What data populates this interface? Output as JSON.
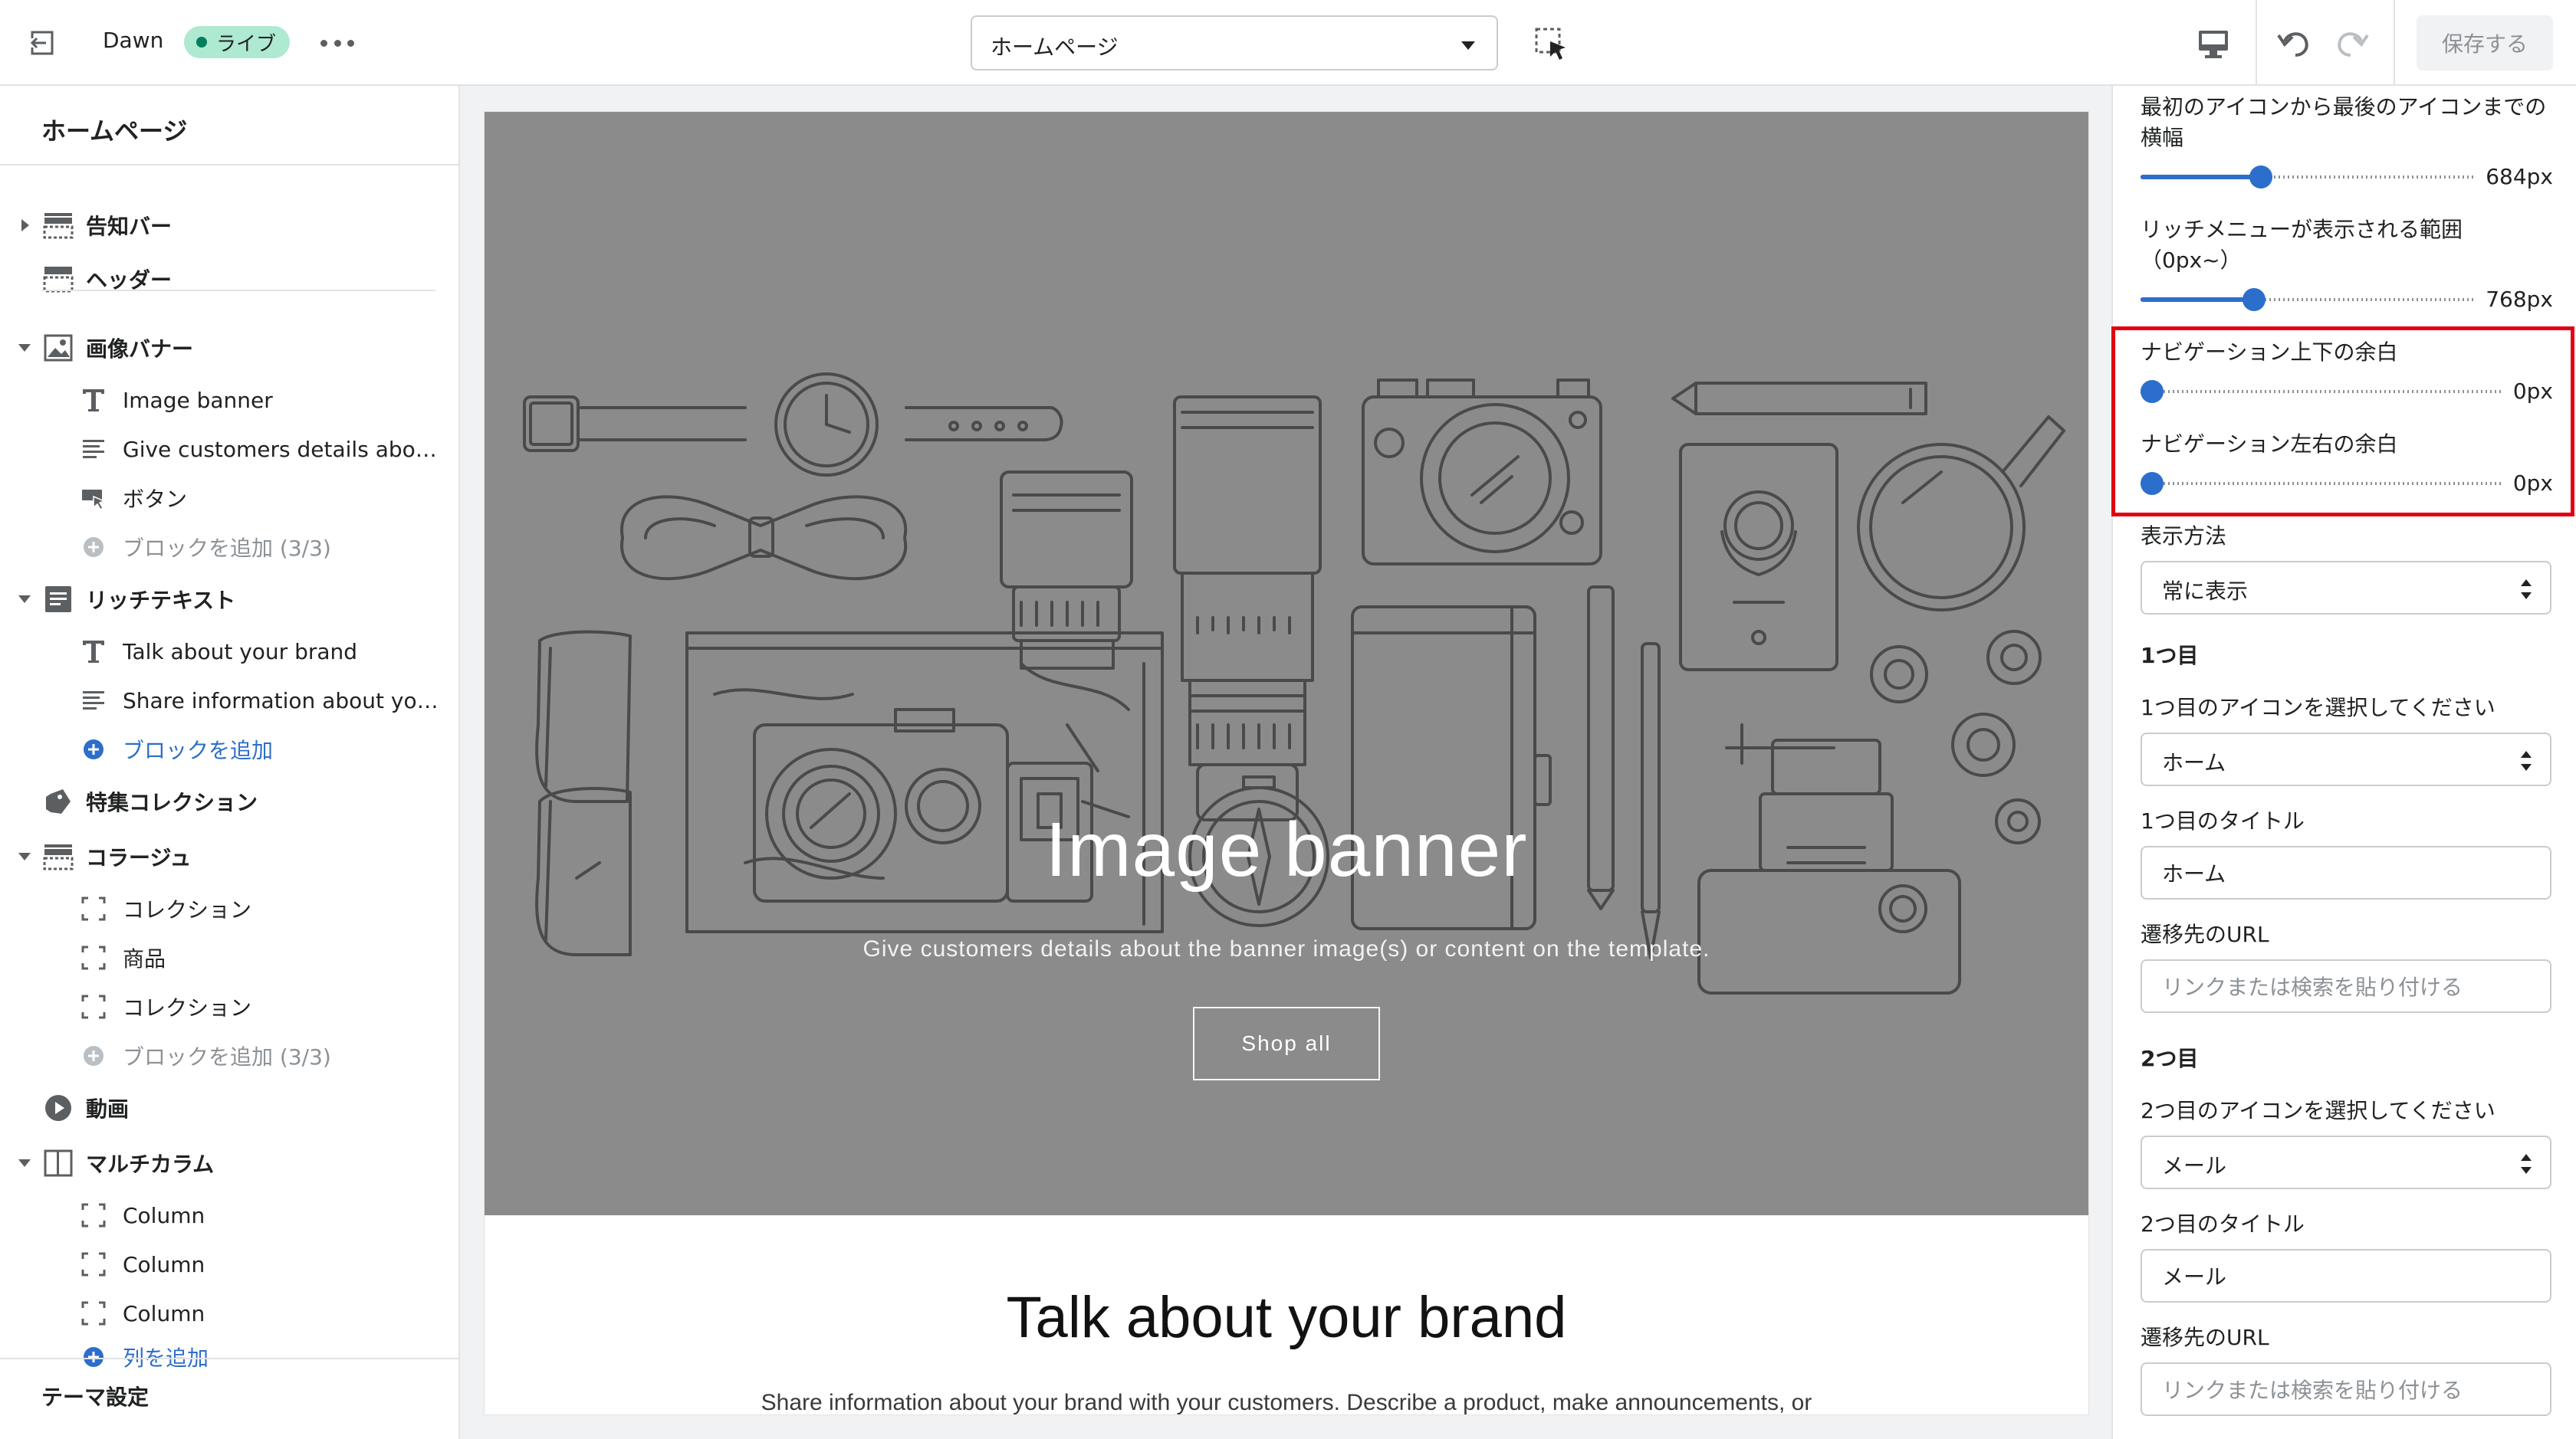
{
  "topbar": {
    "theme_name": "Dawn",
    "status_badge": "ライブ",
    "page_select": "ホームページ",
    "save_label": "保存する"
  },
  "sidebar": {
    "title": "ホームページ",
    "sections": [
      {
        "label": "告知バー",
        "icon": "announcement-bar-icon",
        "collapsed": true
      },
      {
        "label": "ヘッダー",
        "icon": "header-icon"
      },
      {
        "label": "画像バナー",
        "icon": "image-icon",
        "expanded": true,
        "blocks": [
          "Image banner",
          "Give customers details about t...",
          "ボタン"
        ],
        "add_label": "ブロックを追加 (3/3)"
      },
      {
        "label": "リッチテキスト",
        "icon": "text-block-icon",
        "expanded": true,
        "blocks": [
          "Talk about your brand",
          "Share information about your b..."
        ],
        "add_label": "ブロックを追加"
      },
      {
        "label": "特集コレクション",
        "icon": "tag-icon"
      },
      {
        "label": "コラージュ",
        "icon": "collage-icon",
        "expanded": true,
        "blocks": [
          "コレクション",
          "商品",
          "コレクション"
        ],
        "add_label": "ブロックを追加 (3/3)"
      },
      {
        "label": "動画",
        "icon": "play-icon"
      },
      {
        "label": "マルチカラム",
        "icon": "columns-icon",
        "expanded": true,
        "blocks": [
          "Column",
          "Column",
          "Column"
        ],
        "add_label": "列を追加"
      }
    ],
    "theme_settings": "テーマ設定"
  },
  "preview": {
    "banner_title": "Image banner",
    "banner_subtitle": "Give customers details about the banner image(s) or content on the template.",
    "banner_button": "Shop all",
    "richtext_title": "Talk about your brand",
    "richtext_body": "Share information about your brand with your customers. Describe a product, make announcements, or"
  },
  "settings": {
    "width_label_1": "最初のアイコンから最後のアイコンまでの",
    "width_label_2": "横幅",
    "width_value": "684px",
    "width_fraction": 0.36,
    "range_label_1": "リッチメニューが表示される範囲",
    "range_label_2": "（0px~）",
    "range_value": "768px",
    "range_fraction": 0.34,
    "nav_v_label": "ナビゲーション上下の余白",
    "nav_v_value": "0px",
    "nav_h_label": "ナビゲーション左右の余白",
    "nav_h_value": "0px",
    "display_label": "表示方法",
    "display_value": "常に表示",
    "first_heading": "1つ目",
    "first_icon_label": "1つ目のアイコンを選択してください",
    "first_icon_value": "ホーム",
    "first_title_label": "1つ目のタイトル",
    "first_title_value": "ホーム",
    "first_url_label": "遷移先のURL",
    "url_placeholder": "リンクまたは検索を貼り付ける",
    "second_heading": "2つ目",
    "second_icon_label": "2つ目のアイコンを選択してください",
    "second_icon_value": "メール",
    "second_title_label": "2つ目のタイトル",
    "second_title_value": "メール",
    "second_url_label": "遷移先のURL"
  },
  "colors": {
    "accent": "#2c6ecb",
    "highlight_box": "#e3000f",
    "badge_bg": "#aee9d1",
    "banner_bg": "#8b8b8b"
  }
}
